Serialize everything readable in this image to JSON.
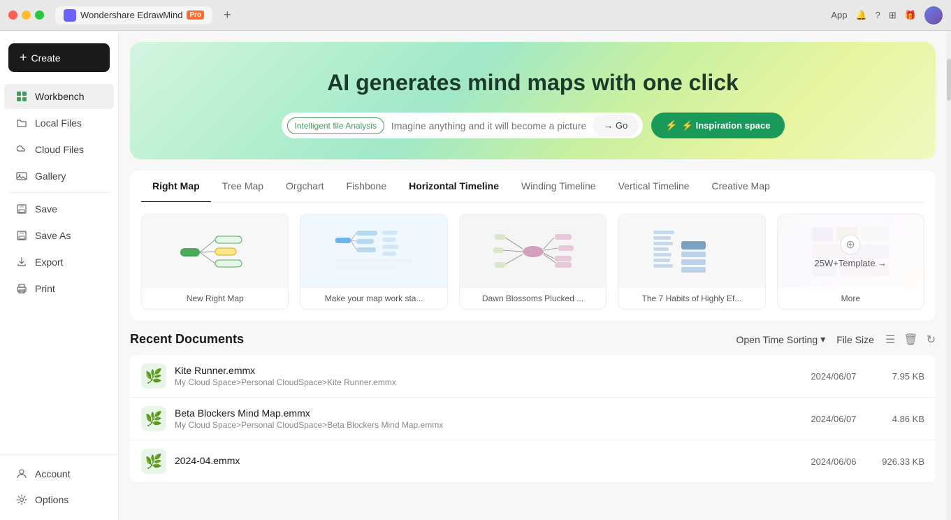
{
  "titlebar": {
    "app_name": "Wondershare EdrawMind",
    "pro_badge": "Pro",
    "tab_plus": "+"
  },
  "titlebar_right": {
    "app_btn": "App",
    "more_options": "..."
  },
  "sidebar": {
    "create_btn": "+ Create",
    "items": [
      {
        "id": "workbench",
        "label": "Workbench",
        "icon": "grid"
      },
      {
        "id": "local-files",
        "label": "Local Files",
        "icon": "folder"
      },
      {
        "id": "cloud-files",
        "label": "Cloud Files",
        "icon": "cloud"
      },
      {
        "id": "gallery",
        "label": "Gallery",
        "icon": "image"
      }
    ],
    "file_items": [
      {
        "id": "save",
        "label": "Save",
        "icon": "save"
      },
      {
        "id": "save-as",
        "label": "Save As",
        "icon": "save-as"
      },
      {
        "id": "export",
        "label": "Export",
        "icon": "export"
      },
      {
        "id": "print",
        "label": "Print",
        "icon": "print"
      }
    ],
    "bottom_items": [
      {
        "id": "account",
        "label": "Account",
        "icon": "account"
      },
      {
        "id": "options",
        "label": "Options",
        "icon": "gear"
      }
    ]
  },
  "hero": {
    "title": "AI generates mind maps with one click",
    "input_placeholder": "Imagine anything and it will become a picture",
    "ai_badge": "Intelligent file Analysis",
    "go_btn": "→ Go",
    "inspiration_btn": "⚡ Inspiration space"
  },
  "template_tabs": [
    {
      "id": "right-map",
      "label": "Right Map",
      "active": true
    },
    {
      "id": "tree-map",
      "label": "Tree Map"
    },
    {
      "id": "orgchart",
      "label": "Orgchart"
    },
    {
      "id": "fishbone",
      "label": "Fishbone"
    },
    {
      "id": "horizontal-timeline",
      "label": "Horizontal Timeline",
      "bold": true
    },
    {
      "id": "winding-timeline",
      "label": "Winding Timeline"
    },
    {
      "id": "vertical-timeline",
      "label": "Vertical Timeline"
    },
    {
      "id": "creative-map",
      "label": "Creative Map"
    }
  ],
  "template_cards": [
    {
      "id": "new-right-map",
      "label": "New Right Map"
    },
    {
      "id": "make-your-map",
      "label": "Make your map work sta..."
    },
    {
      "id": "dawn-blossoms",
      "label": "Dawn Blossoms Plucked ..."
    },
    {
      "id": "7-habits",
      "label": "The 7 Habits of Highly Ef..."
    },
    {
      "id": "more",
      "label": "More",
      "template_count": "25W+Template →"
    }
  ],
  "recent_documents": {
    "title": "Recent Documents",
    "sort_label": "Open Time Sorting",
    "file_size_label": "File Size",
    "items": [
      {
        "id": "kite-runner",
        "name": "Kite Runner.emmx",
        "path": "My Cloud Space>Personal CloudSpace>Kite Runner.emmx",
        "date": "2024/06/07",
        "size": "7.95 KB"
      },
      {
        "id": "beta-blockers",
        "name": "Beta Blockers Mind Map.emmx",
        "path": "My Cloud Space>Personal CloudSpace>Beta Blockers Mind Map.emmx",
        "date": "2024/06/07",
        "size": "4.86 KB"
      },
      {
        "id": "2024-04",
        "name": "2024-04.emmx",
        "path": "",
        "date": "2024/06/06",
        "size": "926.33 KB"
      }
    ]
  },
  "icons": {
    "grid": "⊞",
    "folder": "📁",
    "cloud": "☁",
    "image": "🖼",
    "save": "💾",
    "save_as": "💾",
    "export": "📤",
    "print": "🖨",
    "account": "👤",
    "gear": "⚙",
    "lightning": "⚡",
    "chevron_down": "▾",
    "list_view": "☰",
    "trash": "🗑",
    "refresh": "↻"
  }
}
